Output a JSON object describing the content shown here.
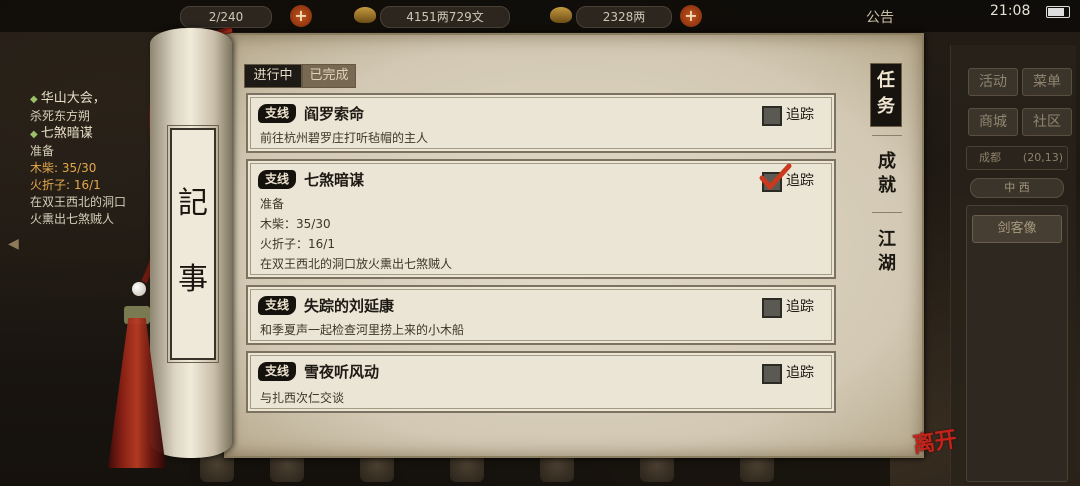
{
  "status_bar": {
    "notice_label": "公告",
    "time": "21:08",
    "silver": "4151两729文",
    "gold": "2328两",
    "stamina": "2/240"
  },
  "left_tracker": {
    "item1_title": "华山大会，",
    "item1_desc": "杀死东方朔",
    "item2_title": "七煞暗谋",
    "item2_status": "准备",
    "item2_wood": "木柴: 35/30",
    "item2_fire": "火折子: 16/1",
    "item2_desc_a": "在双王西北的洞口",
    "item2_desc_b": "火熏出七煞贼人"
  },
  "right_panel": {
    "btn_activity": "活动",
    "btn_menu": "菜单",
    "btn_shop": "商城",
    "btn_community": "社区",
    "location": "成都",
    "coords": "(20,13)",
    "compass": "中 西",
    "sword_btn": "剑客像"
  },
  "journal": {
    "roll_char1": "記",
    "roll_char2": "事",
    "tab_in_progress": "进行中",
    "tab_completed": "已完成",
    "side_tabs": {
      "quests": [
        "任",
        "务"
      ],
      "achievements": [
        "成",
        "就"
      ],
      "jianghu": [
        "江",
        "湖"
      ]
    },
    "track_label": "追踪",
    "quests": [
      {
        "tag": "支线",
        "title": "阎罗索命",
        "lines": [
          "前往杭州碧罗庄打听毡帽的主人"
        ],
        "tracked": false
      },
      {
        "tag": "支线",
        "title": "七煞暗谋",
        "lines": [
          "准备",
          "木柴：35/30",
          "火折子：16/1",
          "在双王西北的洞口放火熏出七煞贼人"
        ],
        "tracked": true
      },
      {
        "tag": "支线",
        "title": "失踪的刘延康",
        "lines": [
          "和季夏声一起检查河里捞上来的小木船"
        ],
        "tracked": false
      },
      {
        "tag": "支线",
        "title": "雪夜听风动",
        "lines": [
          "与扎西次仁交谈"
        ],
        "tracked": false
      }
    ],
    "leave_label": "离开"
  },
  "colors": {
    "tracked_tick": "#c8391d",
    "tag_bg": "#15120e",
    "paper": "#ebe5d5"
  }
}
